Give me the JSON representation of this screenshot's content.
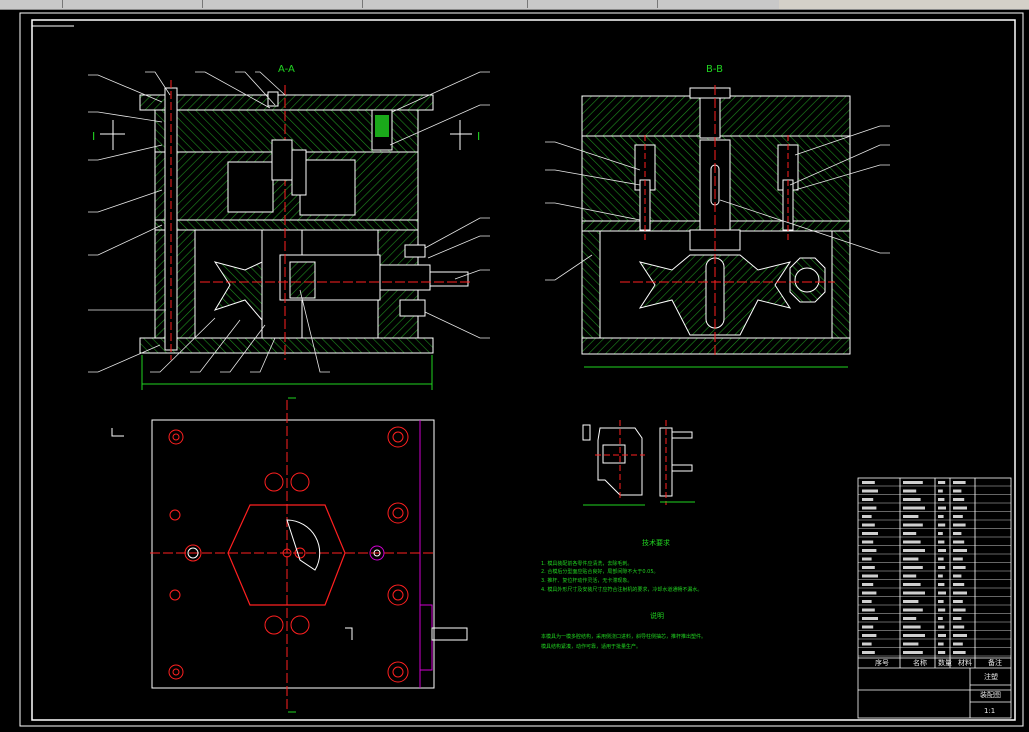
{
  "window": {
    "tabs": [
      "",
      "",
      "",
      "",
      "",
      ""
    ]
  },
  "section_labels": {
    "aa": "A-A",
    "bb": "B-B",
    "view_i_left": "I",
    "view_i_right": "I"
  },
  "notes": {
    "tech_title": "技术要求",
    "tech_items": [
      "1. 模具装配前各零件应清洗，去除毛刺。",
      "2. 合模后分型面应贴合良好，局部间隙不大于0.05。",
      "3. 推杆、复位杆动作灵活，无卡滞现象。",
      "4. 模具外形尺寸及安装尺寸应符合注射机的要求，冷却水道通畅不漏水。"
    ],
    "desc_title": "说明",
    "desc_lines": [
      "本模具为一模多腔结构，采用侧浇口进料，斜导柱侧抽芯，推杆推出塑件。",
      "模具结构紧凑，动作可靠，适用于批量生产。"
    ]
  },
  "title_block": {
    "cell_main": "注塑",
    "cell_name": "装配图",
    "cell_scale": "1:1",
    "footer_cols": [
      "序号",
      "名称",
      "数量",
      "材料",
      "备注"
    ]
  },
  "colors": {
    "outline": "#ffffff",
    "hatch": "#1f8f1f",
    "center": "#ff2020",
    "leader": "#e8e8e8",
    "text_green": "#21d321",
    "magenta": "#d000d0"
  }
}
